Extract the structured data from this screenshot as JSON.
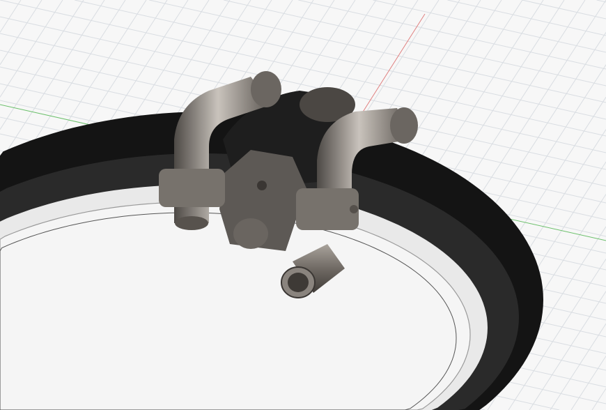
{
  "viewport": {
    "background_color": "#f7f7f7",
    "grid_color": "#d9dde2",
    "x_axis_color": "#e08080",
    "y_axis_color": "#6cc06c",
    "ring_color": "#141414",
    "ring_rim_color": "#e9e9e9",
    "part_color": "#7a7570",
    "part_highlight_color": "#b8b2ab",
    "part_dark_color": "#3c3936"
  }
}
